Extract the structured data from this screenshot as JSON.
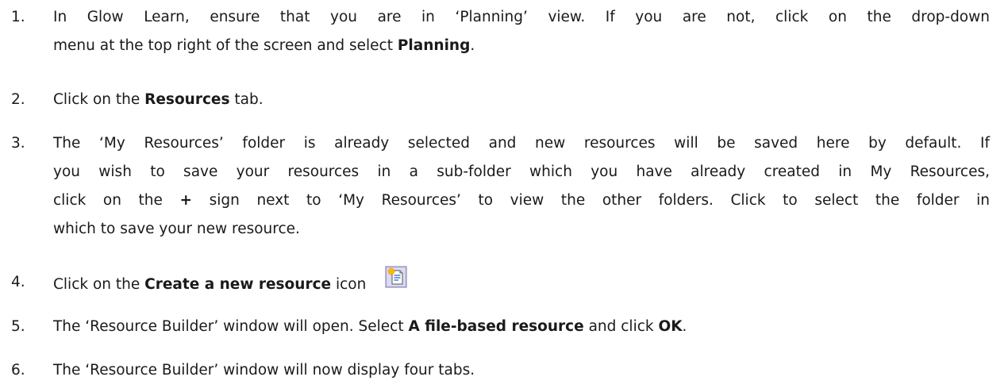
{
  "steps": [
    {
      "num": "1.",
      "lines": [
        [
          "In Glow Learn, ensure that you are in ‘Planning’ view. If you are not, click on the drop-down"
        ],
        [
          "menu at the top right of the screen and select ",
          {
            "b": "Planning"
          },
          "."
        ]
      ]
    },
    {
      "num": "2.",
      "lines": [
        [
          "Click on the ",
          {
            "b": "Resources"
          },
          " tab."
        ]
      ]
    },
    {
      "num": "3.",
      "lines": [
        [
          "The ‘My Resources’ folder is already selected and new resources will be saved here by default. If"
        ],
        [
          "you wish to save your resources in a sub-folder which you have already created in My Resources,"
        ],
        [
          "click on the ",
          {
            "b": "+"
          },
          " sign next to ‘My Resources’ to view the other folders. Click to select the folder in"
        ],
        [
          "which to save your new resource."
        ]
      ]
    },
    {
      "num": "4.",
      "lines": [
        [
          "Click on the ",
          {
            "b": "Create a new resource"
          },
          " icon"
        ]
      ],
      "icon": "create-new-resource-icon"
    },
    {
      "num": "5.",
      "lines": [
        [
          "The ‘Resource Builder’ window will open. Select ",
          {
            "b": "A file-based resource"
          },
          " and click ",
          {
            "b": "OK"
          },
          "."
        ]
      ]
    },
    {
      "num": "6.",
      "lines": [
        [
          "The ‘Resource Builder’ window will now display four tabs."
        ]
      ]
    }
  ]
}
